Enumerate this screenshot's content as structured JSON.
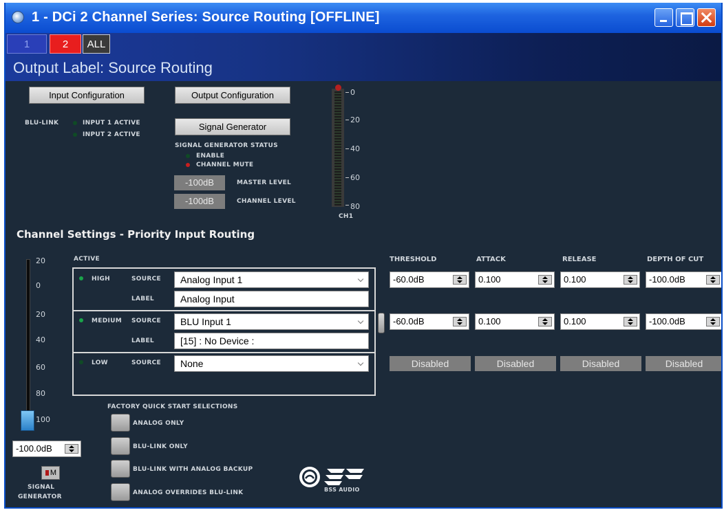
{
  "window": {
    "title": "1 - DCi 2 Channel Series: Source Routing [OFFLINE]"
  },
  "tabs": {
    "t1": "1",
    "t2": "2",
    "all": "ALL"
  },
  "output_label": "Output Label: Source Routing",
  "config": {
    "input_configuration": "Input Configuration",
    "output_configuration": "Output Configuration",
    "signal_generator": "Signal Generator"
  },
  "blulink": {
    "label": "BLU-LINK",
    "input1": "INPUT 1 ACTIVE",
    "input2": "INPUT 2 ACTIVE"
  },
  "siggen_status": {
    "title": "SIGNAL GENERATOR STATUS",
    "enable": "ENABLE",
    "channel_mute": "CHANNEL MUTE",
    "master_value": "-100dB",
    "master_label": "MASTER LEVEL",
    "channel_value": "-100dB",
    "channel_label": "CHANNEL LEVEL"
  },
  "meter": {
    "ticks": [
      "0",
      "20",
      "40",
      "60",
      "80"
    ],
    "label": "CH1"
  },
  "section_title": "Channel Settings - Priority Input Routing",
  "fader": {
    "ticks": [
      "20",
      "0",
      "20",
      "40",
      "60",
      "80",
      "100"
    ],
    "value": "-100.0dB",
    "mute_label": "M",
    "caption_line1": "SIGNAL",
    "caption_line2": "GENERATOR"
  },
  "priority": {
    "active_header": "ACTIVE",
    "source_label": "SOURCE",
    "label_label": "LABEL",
    "rows": [
      {
        "name": "HIGH",
        "source": "Analog Input 1",
        "label": "Analog Input"
      },
      {
        "name": "MEDIUM",
        "source": "BLU Input 1",
        "label": "[15] : No Device :"
      },
      {
        "name": "LOW",
        "source": "None"
      }
    ]
  },
  "dynamics": {
    "headers": {
      "threshold": "THRESHOLD",
      "attack": "ATTACK",
      "release": "RELEASE",
      "depth": "DEPTH OF CUT"
    },
    "row1": {
      "threshold": "-60.0dB",
      "attack": "0.100",
      "release": "0.100",
      "depth": "-100.0dB"
    },
    "row2": {
      "threshold": "-60.0dB",
      "attack": "0.100",
      "release": "0.100",
      "depth": "-100.0dB"
    },
    "row3": {
      "threshold": "Disabled",
      "attack": "Disabled",
      "release": "Disabled",
      "depth": "Disabled"
    }
  },
  "quickstart": {
    "title": "FACTORY QUICK START SELECTIONS",
    "items": [
      "ANALOG ONLY",
      "BLU-LINK ONLY",
      "BLU-LINK WITH ANALOG BACKUP",
      "ANALOG OVERRIDES BLU-LINK"
    ]
  },
  "logo": {
    "text": "BSS AUDIO"
  }
}
